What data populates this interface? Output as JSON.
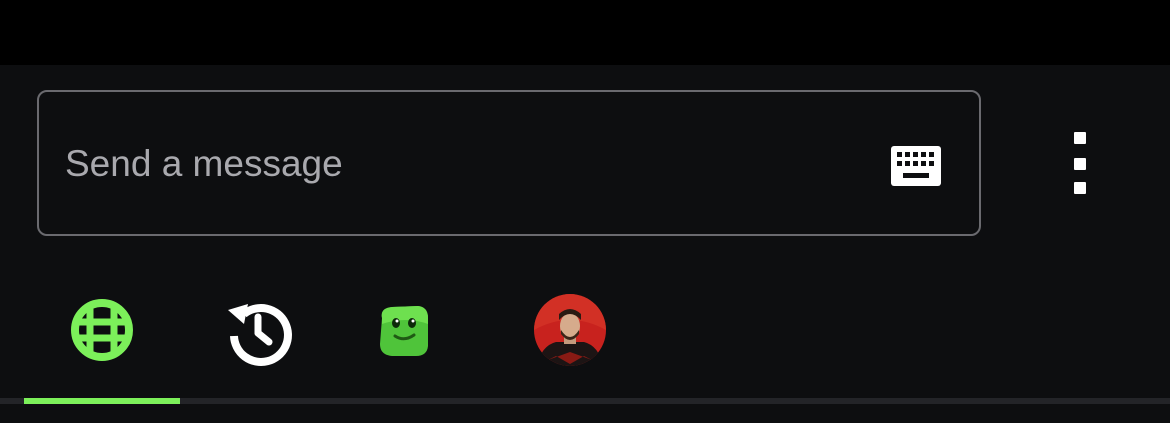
{
  "colors": {
    "accent": "#7cf05a",
    "background": "#0d0e10",
    "top_bar": "#000000",
    "border": "#6a6a6f",
    "placeholder": "#a9a9ae",
    "icon": "#ffffff"
  },
  "composer": {
    "placeholder": "Send a message",
    "value": "",
    "keyboard_icon": "keyboard-icon"
  },
  "more_button": {
    "icon": "more-vertical-icon"
  },
  "tabs": [
    {
      "icon": "globe-grid-icon",
      "selected": true
    },
    {
      "icon": "history-icon",
      "selected": false
    },
    {
      "icon": "green-blob-emote-icon",
      "selected": false
    },
    {
      "icon": "channel-avatar",
      "selected": false
    }
  ]
}
